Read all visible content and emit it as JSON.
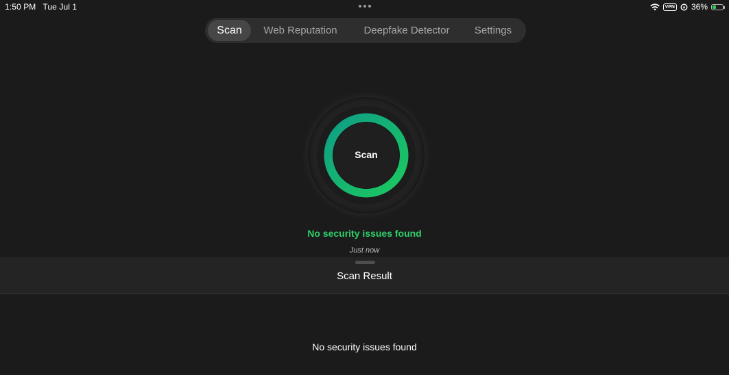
{
  "status_bar": {
    "time": "1:50 PM",
    "date": "Tue Jul 1",
    "vpn": "VPN",
    "battery_percent": "36%",
    "battery_level": 0.36,
    "icons": [
      "wifi-icon",
      "vpn-badge",
      "location-icon",
      "battery-charging-icon"
    ]
  },
  "tabs": [
    {
      "label": "Scan",
      "active": true
    },
    {
      "label": "Web Reputation",
      "active": false
    },
    {
      "label": "Deepfake Detector",
      "active": false
    },
    {
      "label": "Settings",
      "active": false
    }
  ],
  "scan": {
    "button_label": "Scan",
    "result_message": "No security issues found",
    "last_scan": "Just now",
    "ring_colors": [
      "#0fa58a",
      "#19c463"
    ]
  },
  "sheet": {
    "title": "Scan Result",
    "body": "No security issues found"
  },
  "colors": {
    "background": "#1b1b1b",
    "success": "#2fcf6a",
    "tabbar": "#2e2e2e",
    "tab_active": "#464646"
  }
}
